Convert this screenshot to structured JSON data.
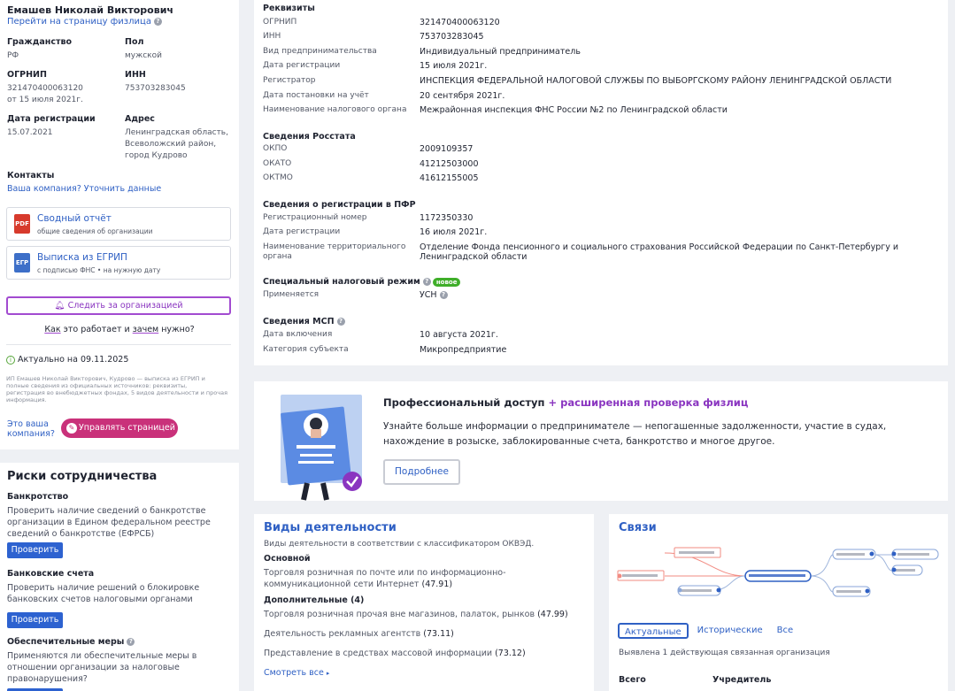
{
  "profile": {
    "name": "Емашев Николай Викторович",
    "person_link": "Перейти на страницу физлица",
    "fields": {
      "citizenship_label": "Гражданство",
      "citizenship": "РФ",
      "gender_label": "Пол",
      "gender": "мужской",
      "ogrnip_label": "ОГРНИП",
      "ogrnip": "321470400063120",
      "ogrnip_date": "от 15 июля 2021г.",
      "inn_label": "ИНН",
      "inn": "753703283045",
      "regdate_label": "Дата регистрации",
      "regdate": "15.07.2021",
      "address_label": "Адрес",
      "address": "Ленинградская область, Всеволожский район, город Кудрово"
    },
    "contacts_label": "Контакты",
    "contacts_link": "Ваша компания? Уточнить данные",
    "summary_btn_title": "Сводный отчёт",
    "summary_btn_sub": "общие сведения об организации",
    "egrip_btn_title": "Выписка из ЕГРИП",
    "egrip_btn_sub": "с подписью ФНС • на нужную дату",
    "follow_btn": "Следить за организацией",
    "how_1": "Как",
    "how_2": " это работает и ",
    "how_3": "зачем",
    "how_4": " нужно?",
    "actual": "Актуально на 09.11.2025",
    "disclaimer": "ИП Емашев Николай Викторович, Кудрово — выписка из ЕГРИП и полные сведения из официальных источников: реквизиты, регистрация во внебюджетных фондах, 5 видов деятельности и прочая информация.",
    "your_company": "Это ваша компания?",
    "manage_btn": "Управлять страницей"
  },
  "risks": {
    "title": "Риски сотрудничества",
    "items": [
      {
        "title": "Банкротство",
        "text": "Проверить наличие сведений о банкротстве организации в Едином федеральном реестре сведений о банкротстве (ЕФРСБ)",
        "button": "Проверить"
      },
      {
        "title": "Банковские счета",
        "text": "Проверить наличие решений о блокировке банковских счетов налоговыми органами",
        "button": "Проверить"
      },
      {
        "title": "Обеспечительные меры",
        "text": "Применяются ли обеспечительные меры в отношении организации за налоговые правонарушения?"
      }
    ]
  },
  "requisites": {
    "title": "Реквизиты",
    "rows": [
      {
        "k": "ОГРНИП",
        "v": "321470400063120"
      },
      {
        "k": "ИНН",
        "v": "753703283045"
      },
      {
        "k": "Вид предпринимательства",
        "v": "Индивидуальный предприниматель"
      },
      {
        "k": "Дата регистрации",
        "v": "15 июля 2021г."
      },
      {
        "k": "Регистратор",
        "v": "ИНСПЕКЦИЯ ФЕДЕРАЛЬНОЙ НАЛОГОВОЙ СЛУЖБЫ ПО ВЫБОРГСКОМУ РАЙОНУ ЛЕНИНГРАДСКОЙ ОБЛАСТИ"
      },
      {
        "k": "Дата постановки на учёт",
        "v": "20 сентября 2021г."
      },
      {
        "k": "Наименование налогового органа",
        "v": "Межрайонная инспекция ФНС России №2 по Ленинградской области"
      }
    ],
    "rosstat_title": "Сведения Росстата",
    "rosstat": [
      {
        "k": "ОКПО",
        "v": "2009109357"
      },
      {
        "k": "ОКАТО",
        "v": "41212503000"
      },
      {
        "k": "ОКТМО",
        "v": "41612155005"
      }
    ],
    "pfr_title": "Сведения о регистрации в ПФР",
    "pfr": [
      {
        "k": "Регистрационный номер",
        "v": "1172350330"
      },
      {
        "k": "Дата регистрации",
        "v": "16 июля 2021г."
      },
      {
        "k": "Наименование территориального органа",
        "v": "Отделение Фонда пенсионного и социального страхования Российской Федерации по Санкт-Петербургу и Ленинградской области"
      }
    ],
    "tax_title": "Специальный налоговый режим",
    "tax_badge": "новое",
    "tax_k": "Применяется",
    "tax_v": "УСН",
    "msp_title": "Сведения МСП",
    "msp": [
      {
        "k": "Дата включения",
        "v": "10 августа 2021г."
      },
      {
        "k": "Категория субъекта",
        "v": "Микропредприятие"
      }
    ]
  },
  "pro": {
    "title_main": "Профессиональный доступ",
    "title_plus": " + расширенная проверка физлиц",
    "desc": "Узнайте больше информации о предпринимателе — непогашенные задолженности, участие в судах, нахождение в розыске, заблокированные счета, банкротство и многое другое.",
    "button": "Подробнее"
  },
  "activities": {
    "title": "Виды деятельности",
    "subtitle": "Виды деятельности в соответствии с классификатором ОКВЭД.",
    "main_label": "Основной",
    "main_text": "Торговля розничная по почте или по информационно-коммуникационной сети Интернет",
    "main_code": "(47.91)",
    "extra_label": "Дополнительные (4)",
    "extra": [
      {
        "text": "Торговля розничная прочая вне магазинов, палаток, рынков",
        "code": "(47.99)"
      },
      {
        "text": "Деятельность рекламных агентств",
        "code": "(73.11)"
      },
      {
        "text": "Представление в средствах массовой информации",
        "code": "(73.12)"
      }
    ],
    "see_all": "Смотреть все"
  },
  "links": {
    "title": "Связи",
    "tabs": [
      "Актуальные",
      "Исторические",
      "Все"
    ],
    "found": "Выявлена 1 действующая связанная организация",
    "col1": "Всего",
    "col2": "Учредитель"
  }
}
